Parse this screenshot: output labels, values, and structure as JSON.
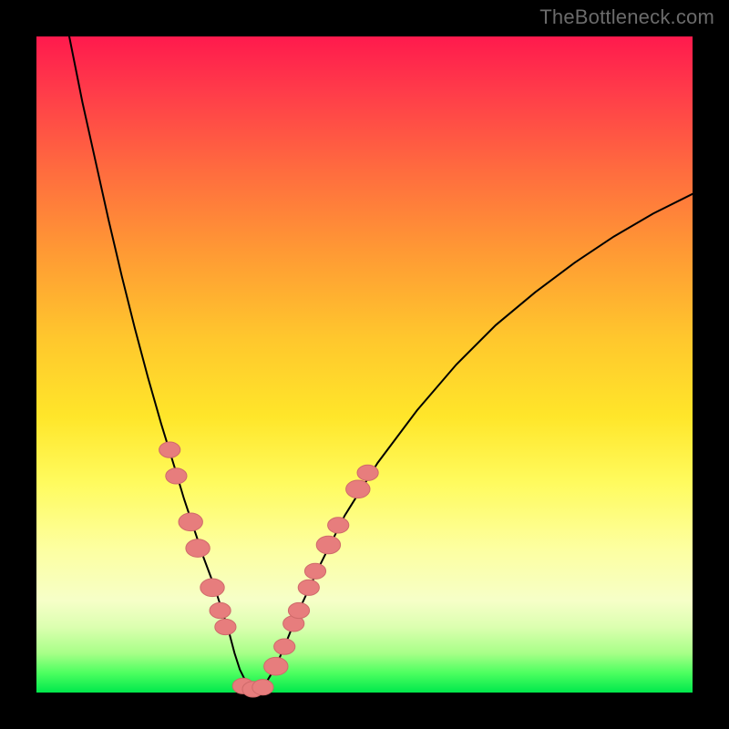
{
  "attribution": "TheBottleneck.com",
  "colors": {
    "frame_bg_top": "#ff1a4d",
    "frame_bg_bottom": "#00e84c",
    "curve": "#000000",
    "dot_fill": "#e77d7d",
    "dot_stroke": "#cf6a6a",
    "page_bg": "#000000",
    "attribution_text": "#6b6b6b"
  },
  "chart_data": {
    "type": "line",
    "title": "",
    "xlabel": "",
    "ylabel": "",
    "xlim": [
      0,
      100
    ],
    "ylim": [
      0,
      100
    ],
    "grid": false,
    "legend": false,
    "series": [
      {
        "name": "bottleneck-curve",
        "x": [
          5,
          7,
          9,
          11,
          13,
          15,
          17,
          19,
          21,
          22.5,
          24,
          25.5,
          27,
          28.3,
          29.4,
          30.2,
          31,
          32,
          33,
          34,
          35,
          36.5,
          38,
          40,
          43,
          47,
          52,
          58,
          64,
          70,
          76,
          82,
          88,
          94,
          100
        ],
        "y": [
          100,
          90,
          81,
          72,
          63.5,
          55.5,
          48,
          41,
          34.5,
          29.5,
          25,
          20.5,
          16.5,
          12.5,
          9,
          6,
          3.5,
          1.5,
          0.5,
          0.5,
          1.5,
          4,
          7.5,
          12.5,
          19,
          27,
          35,
          43,
          50,
          56,
          61,
          65.5,
          69.5,
          73,
          76
        ]
      }
    ],
    "markers": [
      {
        "x": 20.3,
        "y": 37.0,
        "r": 1.4
      },
      {
        "x": 21.3,
        "y": 33.0,
        "r": 1.4
      },
      {
        "x": 23.5,
        "y": 26.0,
        "r": 1.6
      },
      {
        "x": 24.6,
        "y": 22.0,
        "r": 1.6
      },
      {
        "x": 26.8,
        "y": 16.0,
        "r": 1.6
      },
      {
        "x": 28.0,
        "y": 12.5,
        "r": 1.4
      },
      {
        "x": 28.8,
        "y": 10.0,
        "r": 1.4
      },
      {
        "x": 31.5,
        "y": 1.0,
        "r": 1.4
      },
      {
        "x": 33.0,
        "y": 0.5,
        "r": 1.4
      },
      {
        "x": 34.5,
        "y": 0.8,
        "r": 1.4
      },
      {
        "x": 36.5,
        "y": 4.0,
        "r": 1.6
      },
      {
        "x": 37.8,
        "y": 7.0,
        "r": 1.4
      },
      {
        "x": 39.2,
        "y": 10.5,
        "r": 1.4
      },
      {
        "x": 40.0,
        "y": 12.5,
        "r": 1.4
      },
      {
        "x": 41.5,
        "y": 16.0,
        "r": 1.4
      },
      {
        "x": 42.5,
        "y": 18.5,
        "r": 1.4
      },
      {
        "x": 44.5,
        "y": 22.5,
        "r": 1.6
      },
      {
        "x": 46.0,
        "y": 25.5,
        "r": 1.4
      },
      {
        "x": 49.0,
        "y": 31.0,
        "r": 1.6
      },
      {
        "x": 50.5,
        "y": 33.5,
        "r": 1.4
      }
    ]
  }
}
